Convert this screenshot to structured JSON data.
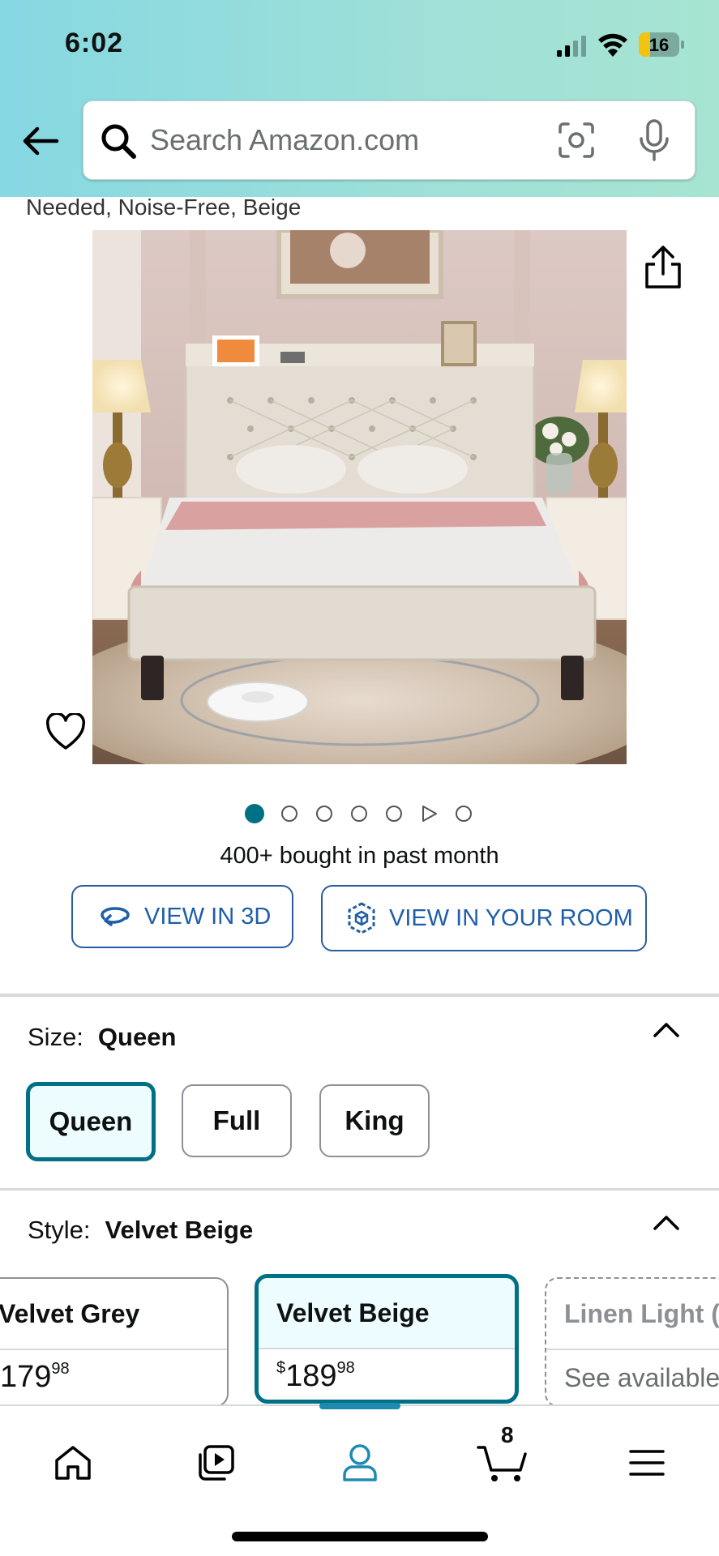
{
  "status_bar": {
    "time": "6:02",
    "battery_level": "16",
    "battery_fraction": 0.16
  },
  "search": {
    "placeholder": "Search Amazon.com"
  },
  "product": {
    "title_fragment": "Needed, Noise-Free, Beige",
    "image_count": 7,
    "active_image_index": 0,
    "bought_text": "400+ bought in past month",
    "view_3d_label": "VIEW IN 3D",
    "view_room_label": "VIEW IN YOUR ROOM"
  },
  "size": {
    "label": "Size:",
    "selected": "Queen",
    "options": [
      "Queen",
      "Full",
      "King"
    ]
  },
  "style": {
    "label": "Style:",
    "selected": "Velvet Beige",
    "options": [
      {
        "name": "Velvet Grey",
        "price_whole": "179",
        "price_fraction": "98"
      },
      {
        "name": "Velvet Beige",
        "price_symbol": "$",
        "price_whole": "189",
        "price_fraction": "98"
      },
      {
        "name": "Linen Light (",
        "availability": "See available"
      }
    ]
  },
  "bottom_nav": {
    "items": [
      "home-icon",
      "video-icon",
      "account-icon",
      "cart-icon",
      "menu-icon"
    ],
    "active": "account-icon",
    "cart_count": "8"
  },
  "colors": {
    "accent_teal": "#007185",
    "link_blue": "#1f5ea8",
    "header_gradient_start": "#86d8e2",
    "header_gradient_end": "#a7e4d2"
  }
}
